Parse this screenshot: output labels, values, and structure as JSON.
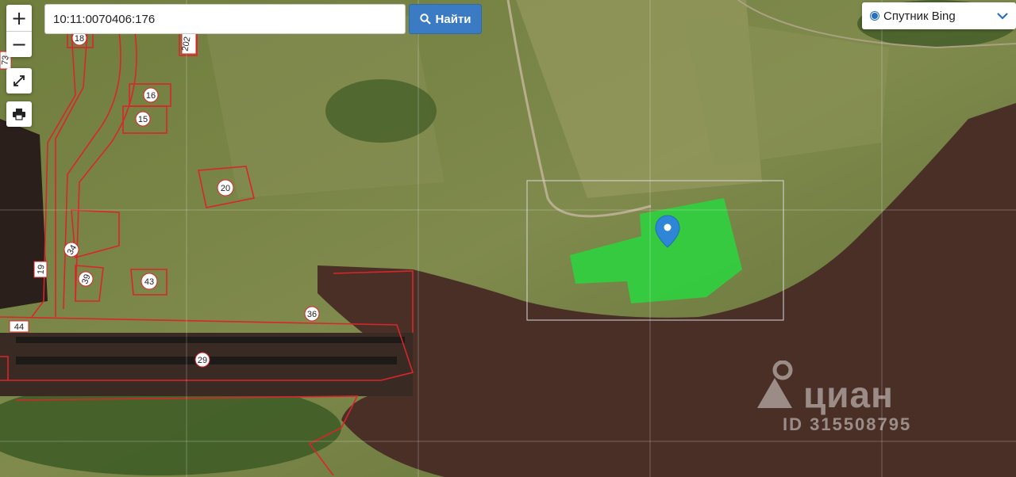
{
  "search": {
    "value": "10:11:0070406:176",
    "button_label": "Найти"
  },
  "controls": {
    "zoom_in": "+",
    "zoom_out": "−"
  },
  "layer": {
    "selected": "Спутник Bing"
  },
  "parcel_labels": [
    "18",
    "202",
    "73",
    "16",
    "15",
    "20",
    "34",
    "39",
    "43",
    "19",
    "44",
    "36",
    "29"
  ],
  "watermark": {
    "brand": "циан",
    "id": "ID 315508795"
  },
  "colors": {
    "parcel_outline": "#d8262b",
    "selected_parcel": "#27d93e",
    "marker": "#2f86d6",
    "button": "#3b7bc4"
  }
}
